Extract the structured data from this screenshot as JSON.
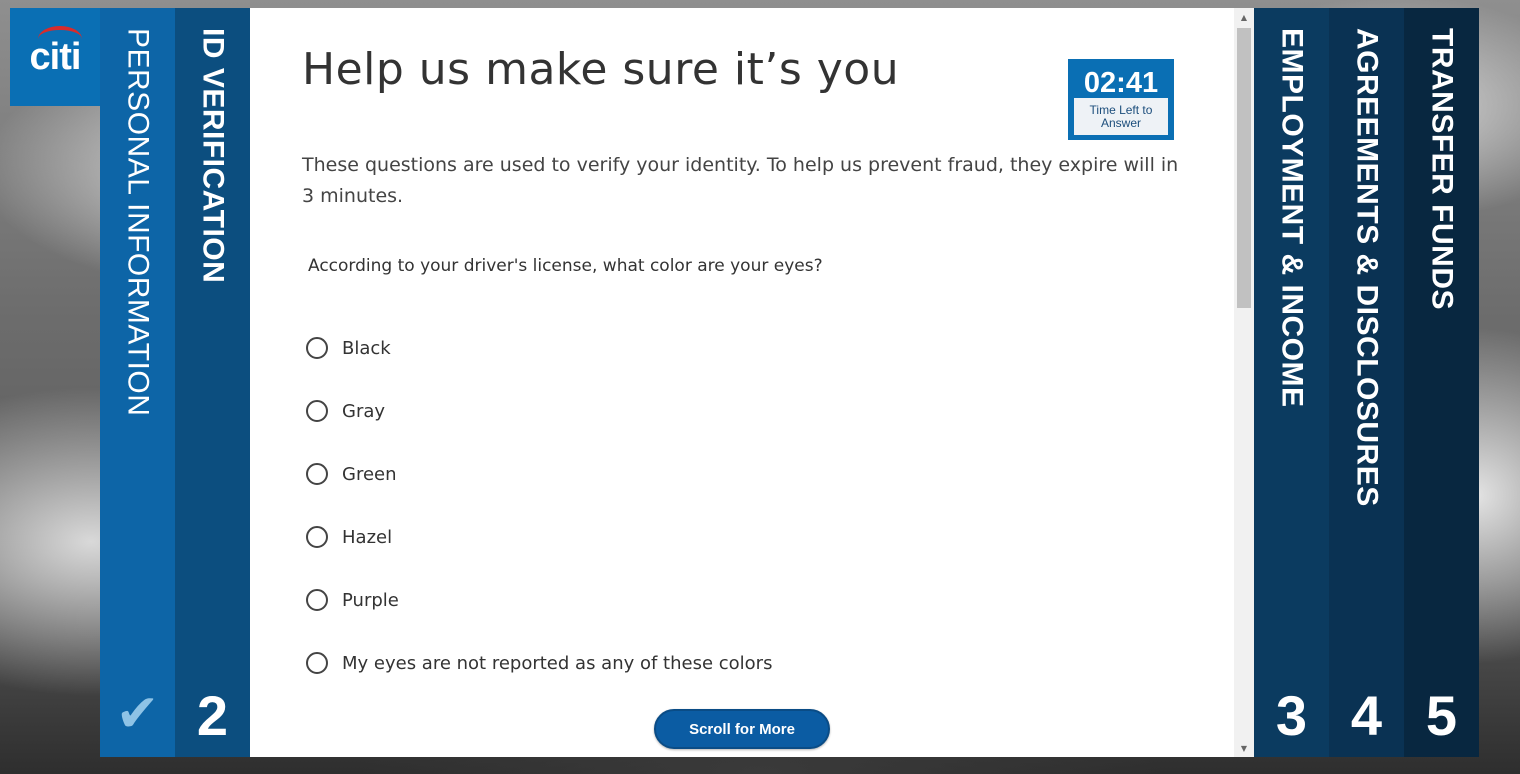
{
  "brand": {
    "logo_text": "citi"
  },
  "steps": [
    {
      "label": "PERSONAL INFORMATION",
      "number": "",
      "completed": true,
      "marker": "check-icon"
    },
    {
      "label": "ID VERIFICATION",
      "number": "2",
      "active": true
    },
    {
      "label": "EMPLOYMENT & INCOME",
      "number": "3"
    },
    {
      "label": "AGREEMENTS & DISCLOSURES",
      "number": "4"
    },
    {
      "label": "TRANSFER FUNDS",
      "number": "5"
    }
  ],
  "main": {
    "title": "Help us make sure it’s you",
    "intro": "These questions are used to verify your identity. To help us prevent fraud, they expire will in 3 minutes.",
    "timer": {
      "value": "02:41",
      "caption": "Time Left to Answer"
    },
    "question": "According to your driver's license, what color are your eyes?",
    "options": [
      "Black",
      "Gray",
      "Green",
      "Hazel",
      "Purple",
      "My eyes are not reported as any of these colors"
    ],
    "scroll_button": "Scroll for More"
  },
  "colors": {
    "primary": "#0a6fb4",
    "step1": "#0d65a7",
    "step2": "#0c4e7f",
    "step3": "#0b3b60",
    "step4": "#0a3253",
    "step5": "#082740"
  }
}
